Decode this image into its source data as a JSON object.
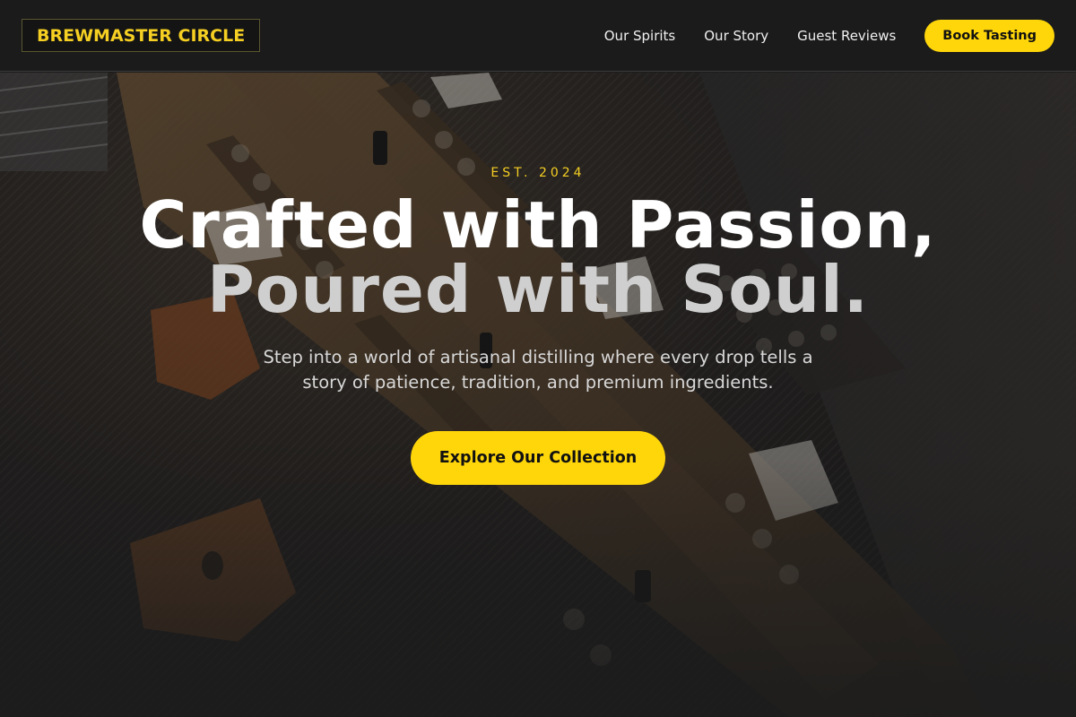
{
  "header": {
    "logo_text": "BREWMASTER CIRCLE",
    "nav": [
      "Our Spirits",
      "Our Story",
      "Guest Reviews"
    ],
    "cta_label": "Book Tasting"
  },
  "hero": {
    "eyebrow": "EST. 2024",
    "headline_line1": "Crafted with Passion,",
    "headline_line2": "Poured with Soul.",
    "subcopy": "Step into a world of artisanal distilling where every drop tells a story of patience, tradition, and premium ingredients.",
    "cta_label": "Explore Our Collection"
  },
  "colors": {
    "accent": "#ffd60a",
    "background": "#1c1c1c",
    "text": "#ffffff"
  }
}
